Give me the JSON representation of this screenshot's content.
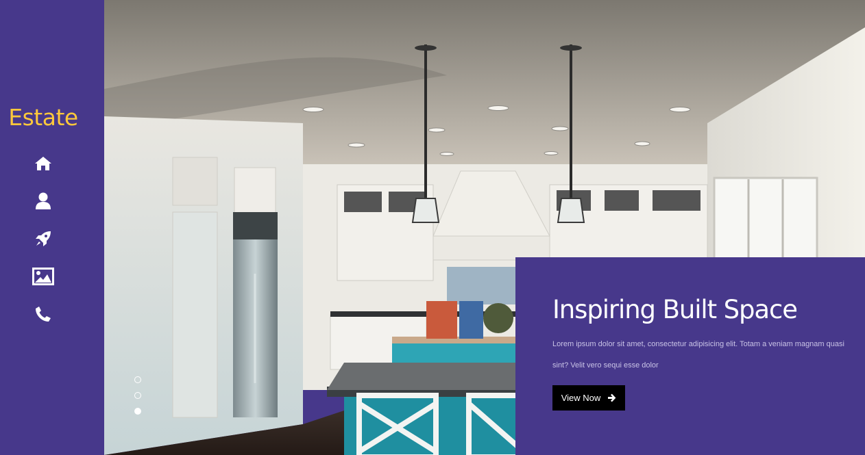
{
  "brand": {
    "name": "Estate",
    "color": "#ffc83b"
  },
  "theme": {
    "panel_color": "#47388b",
    "button_color": "#000000"
  },
  "nav": {
    "icons": [
      "home-icon",
      "user-icon",
      "rocket-icon",
      "image-icon",
      "phone-icon"
    ]
  },
  "slider": {
    "total_slides": 3,
    "active_index": 2
  },
  "hero": {
    "title": "Inspiring Built Space",
    "description": "Lorem ipsum dolor sit amet, consectetur adipisicing elit. Totam a veniam magnam quasi sint? Velit vero sequi esse dolor",
    "cta_label": "View Now"
  }
}
